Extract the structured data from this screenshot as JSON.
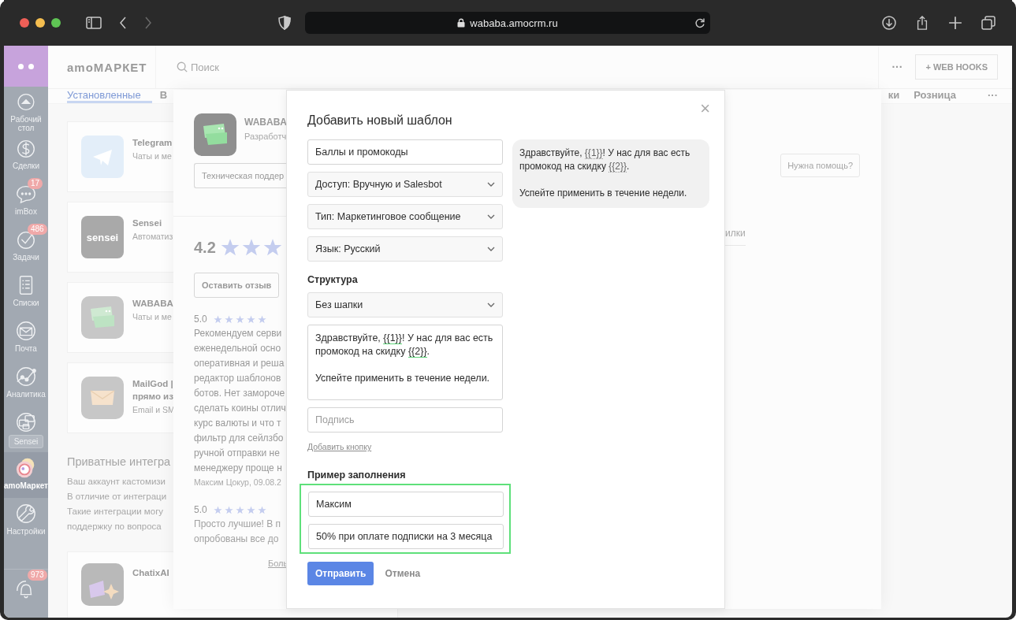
{
  "browser": {
    "url": "wababa.amocrm.ru"
  },
  "sidebar": {
    "items": [
      {
        "label": "Рабочий стол",
        "kind": "plain",
        "selected": false
      },
      {
        "label": "Сделки",
        "kind": "plain",
        "selected": false
      },
      {
        "label": "imBox",
        "kind": "plain",
        "badge": "17",
        "selected": false
      },
      {
        "label": "Задачи",
        "kind": "plain",
        "badge": "486",
        "selected": false
      },
      {
        "label": "Списки",
        "kind": "plain",
        "selected": false
      },
      {
        "label": "Почта",
        "kind": "plain",
        "selected": false
      },
      {
        "label": "Аналитика",
        "kind": "plain",
        "selected": false
      },
      {
        "label": "Sensei",
        "kind": "tag",
        "selected": false
      },
      {
        "label": "amoМаркет",
        "kind": "plain",
        "selected": true
      },
      {
        "label": "Настройки",
        "kind": "plain",
        "selected": false
      },
      {
        "kind": "bottom",
        "badge": "973",
        "selected": false
      }
    ]
  },
  "header": {
    "logo": "amoМАРКЕТ",
    "search_placeholder": "Поиск",
    "more": "···",
    "webhooks_button": "+ WEB HOOKS"
  },
  "tabs": [
    {
      "label": "Установленные",
      "selected": true
    },
    {
      "label": "В",
      "selected": false
    }
  ],
  "tabs_right": [
    {
      "label": "ки",
      "selected": false
    },
    {
      "label": "Розница",
      "selected": false
    },
    {
      "label": "···",
      "selected": false
    }
  ],
  "cards": [
    {
      "title": [
        "Telegram"
      ],
      "subtitle": "Чаты и ме"
    },
    {
      "logo_text": "sensei",
      "title": [
        "Sensei"
      ],
      "subtitle": "Автоматиз"
    },
    {
      "title": [
        "WABABA"
      ],
      "subtitle": "Чаты и ме"
    },
    {
      "title": [
        "MailGod |",
        "прямо из"
      ],
      "subtitle": "Email и SM"
    }
  ],
  "private": {
    "heading": "Приватные интегра",
    "lines": [
      "Ваш аккаунт кастомизи",
      "В отличие от интеграци",
      "Такие интеграции могу",
      "поддержку по вопроса"
    ]
  },
  "private_cards": [
    {
      "title": [
        "ChatixAI"
      ]
    }
  ],
  "app_panel": {
    "name": "WABABA",
    "developer": "Разработч",
    "support_button": "Техническая поддер",
    "rating": "4.2",
    "stars": 3,
    "review_button": "Оставить отзыв",
    "reviews": [
      {
        "score": "5.0",
        "stars": 5,
        "lines": [
          "Рекомендуем серви",
          "еженедельной осно",
          "оперативная и реша",
          "редактор шаблонов",
          "ботов. Нет замороче",
          "сделать коины отлич",
          "курс валюты и что т",
          "фильтр для сейлзбо",
          "ручной отправки не",
          "менеджеру проще н"
        ],
        "author": "Максим Цокур, 09.08.2"
      },
      {
        "score": "5.0",
        "stars": 5,
        "lines": [
          "Просто лучшие! В п",
          "опробованы все до"
        ]
      }
    ],
    "more_link": "Боль",
    "tab": "илки",
    "help_button": "Нужна помощь?"
  },
  "modal": {
    "title": "Добавить новый шаблон",
    "close": "×",
    "name_field": {
      "value": "Баллы и промокоды"
    },
    "selects": [
      {
        "value": "Доступ: Вручную и Salesbot"
      },
      {
        "value": "Тип: Маркетинговое сообщение"
      },
      {
        "value": "Язык: Русский"
      }
    ],
    "structure_label": "Структура",
    "header_select": {
      "value": "Без шапки"
    },
    "body": [
      {
        "kind": "text",
        "text": "Здравствуйте, "
      },
      {
        "kind": "variable",
        "text": "{{1}}"
      },
      {
        "kind": "text",
        "text": "! У нас для вас есть промокод на скидку "
      },
      {
        "kind": "variable",
        "text": "{{2}}"
      },
      {
        "kind": "text",
        "text": ".\n\nУспейте применить в течение недели."
      }
    ],
    "signature": {
      "placeholder": "Подпись"
    },
    "add_button_link": "Добавить кнопку",
    "example": {
      "label": "Пример заполнения",
      "highlighted": true,
      "fields": [
        {
          "value": "Максим"
        },
        {
          "value": "50% при оплате подписки на 3 месяца"
        }
      ]
    },
    "buttons": [
      {
        "label": "Отправить",
        "kind": "primary"
      },
      {
        "label": "Отмена",
        "kind": "secondary"
      }
    ],
    "preview": [
      {
        "kind": "text",
        "text": "Здравствуйте, "
      },
      {
        "kind": "variable",
        "text": "{{1}}"
      },
      {
        "kind": "text",
        "text": "! У нас для вас есть промокод на скидку "
      },
      {
        "kind": "variable",
        "text": "{{2}}"
      },
      {
        "kind": "text",
        "text": ".\n\nУспейте применить в течение недели."
      }
    ]
  }
}
